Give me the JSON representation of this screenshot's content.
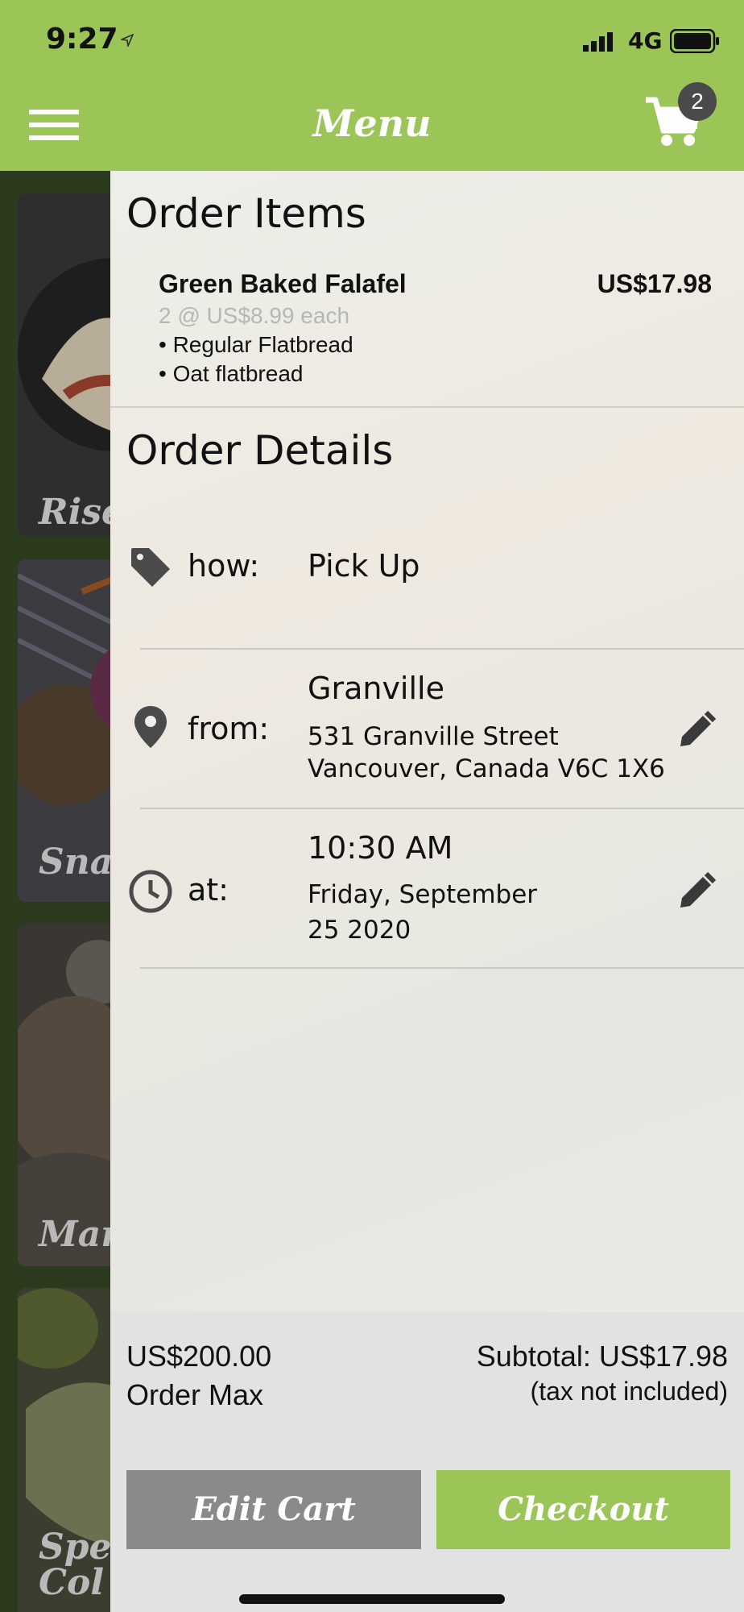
{
  "status": {
    "time": "9:27",
    "network": "4G"
  },
  "header": {
    "title": "Menu",
    "cart_count": "2"
  },
  "background_menu": {
    "cards": [
      "Rise",
      "Sna",
      "Mar",
      "Spec\nCol"
    ]
  },
  "order_items": {
    "heading": "Order Items",
    "items": [
      {
        "name": "Green Baked Falafel",
        "price": "US$17.98",
        "qty": "2 @ US$8.99 each",
        "options": [
          "• Regular Flatbread",
          "• Oat flatbread"
        ]
      }
    ]
  },
  "order_details": {
    "heading": "Order Details",
    "how": {
      "label": "how:",
      "value": "Pick Up"
    },
    "from": {
      "label": "from:",
      "name": "Granville",
      "address1": "531 Granville Street",
      "address2": "Vancouver, Canada V6C 1X6"
    },
    "at": {
      "label": "at:",
      "time": "10:30 AM",
      "date1": "Friday, September",
      "date2": "25 2020"
    }
  },
  "footer": {
    "order_max_value": "US$200.00",
    "order_max_label": "Order Max",
    "subtotal": "Subtotal: US$17.98",
    "tax_note": "(tax not included)",
    "edit_label": "Edit Cart",
    "checkout_label": "Checkout"
  },
  "colors": {
    "brand_green": "#9bc556",
    "edit_gray": "#8a8a8a"
  }
}
